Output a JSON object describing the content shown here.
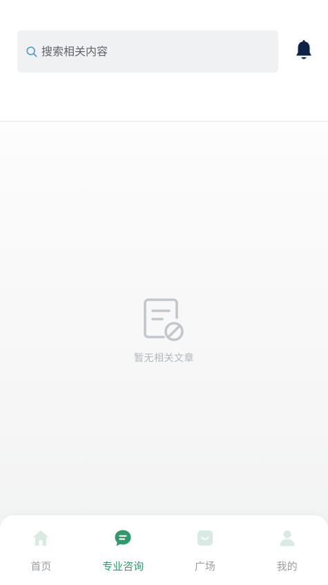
{
  "search": {
    "placeholder": "搜索相关内容"
  },
  "empty_state": {
    "message": "暂无相关文章"
  },
  "tabbar": {
    "items": [
      {
        "label": "首页",
        "icon": "home-icon",
        "active": false
      },
      {
        "label": "专业咨询",
        "icon": "chat-icon",
        "active": true
      },
      {
        "label": "广场",
        "icon": "plaza-icon",
        "active": false
      },
      {
        "label": "我的",
        "icon": "profile-icon",
        "active": false
      }
    ]
  },
  "colors": {
    "accent": "#2f9a6c",
    "inactive_icon": "#d7ebe2",
    "bell": "#0f2348",
    "search_icon": "#4a9bc4"
  }
}
